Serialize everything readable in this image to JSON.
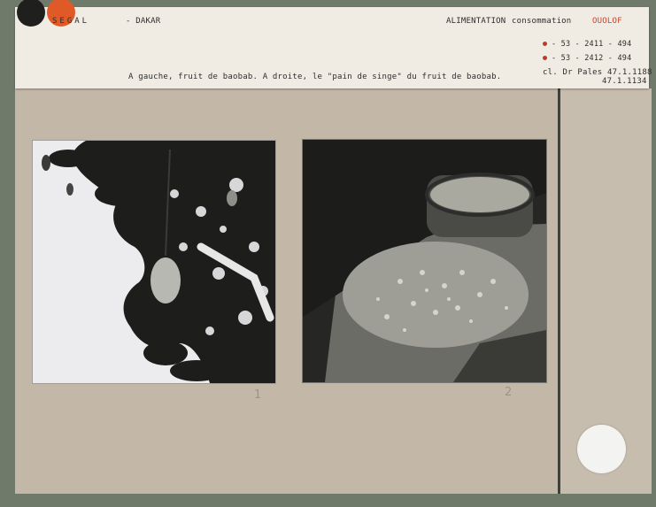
{
  "label": {
    "country": "SEGAL",
    "city": "- DAKAR",
    "topic": "ALIMENTATION",
    "subtopic": "consommation",
    "ethnic_group": "OUOLOF",
    "ref_1": "- 53 - 2411 - 494",
    "ref_2": "- 53 - 2412 - 494",
    "credit": "cl. Dr Pales 47.1.1188",
    "credit_2": "47.1.1134",
    "caption": "A gauche, fruit de baobab. A droite, le \"pain de singe\" du fruit de baobab."
  },
  "pencil_marks": {
    "left": "1",
    "right": "2"
  },
  "colors": {
    "board": "#c3b8a8",
    "card": "#f0ece4",
    "accent_text": "#d6402a",
    "punch_black": "#1f1f1d",
    "punch_orange": "#e05a28"
  }
}
